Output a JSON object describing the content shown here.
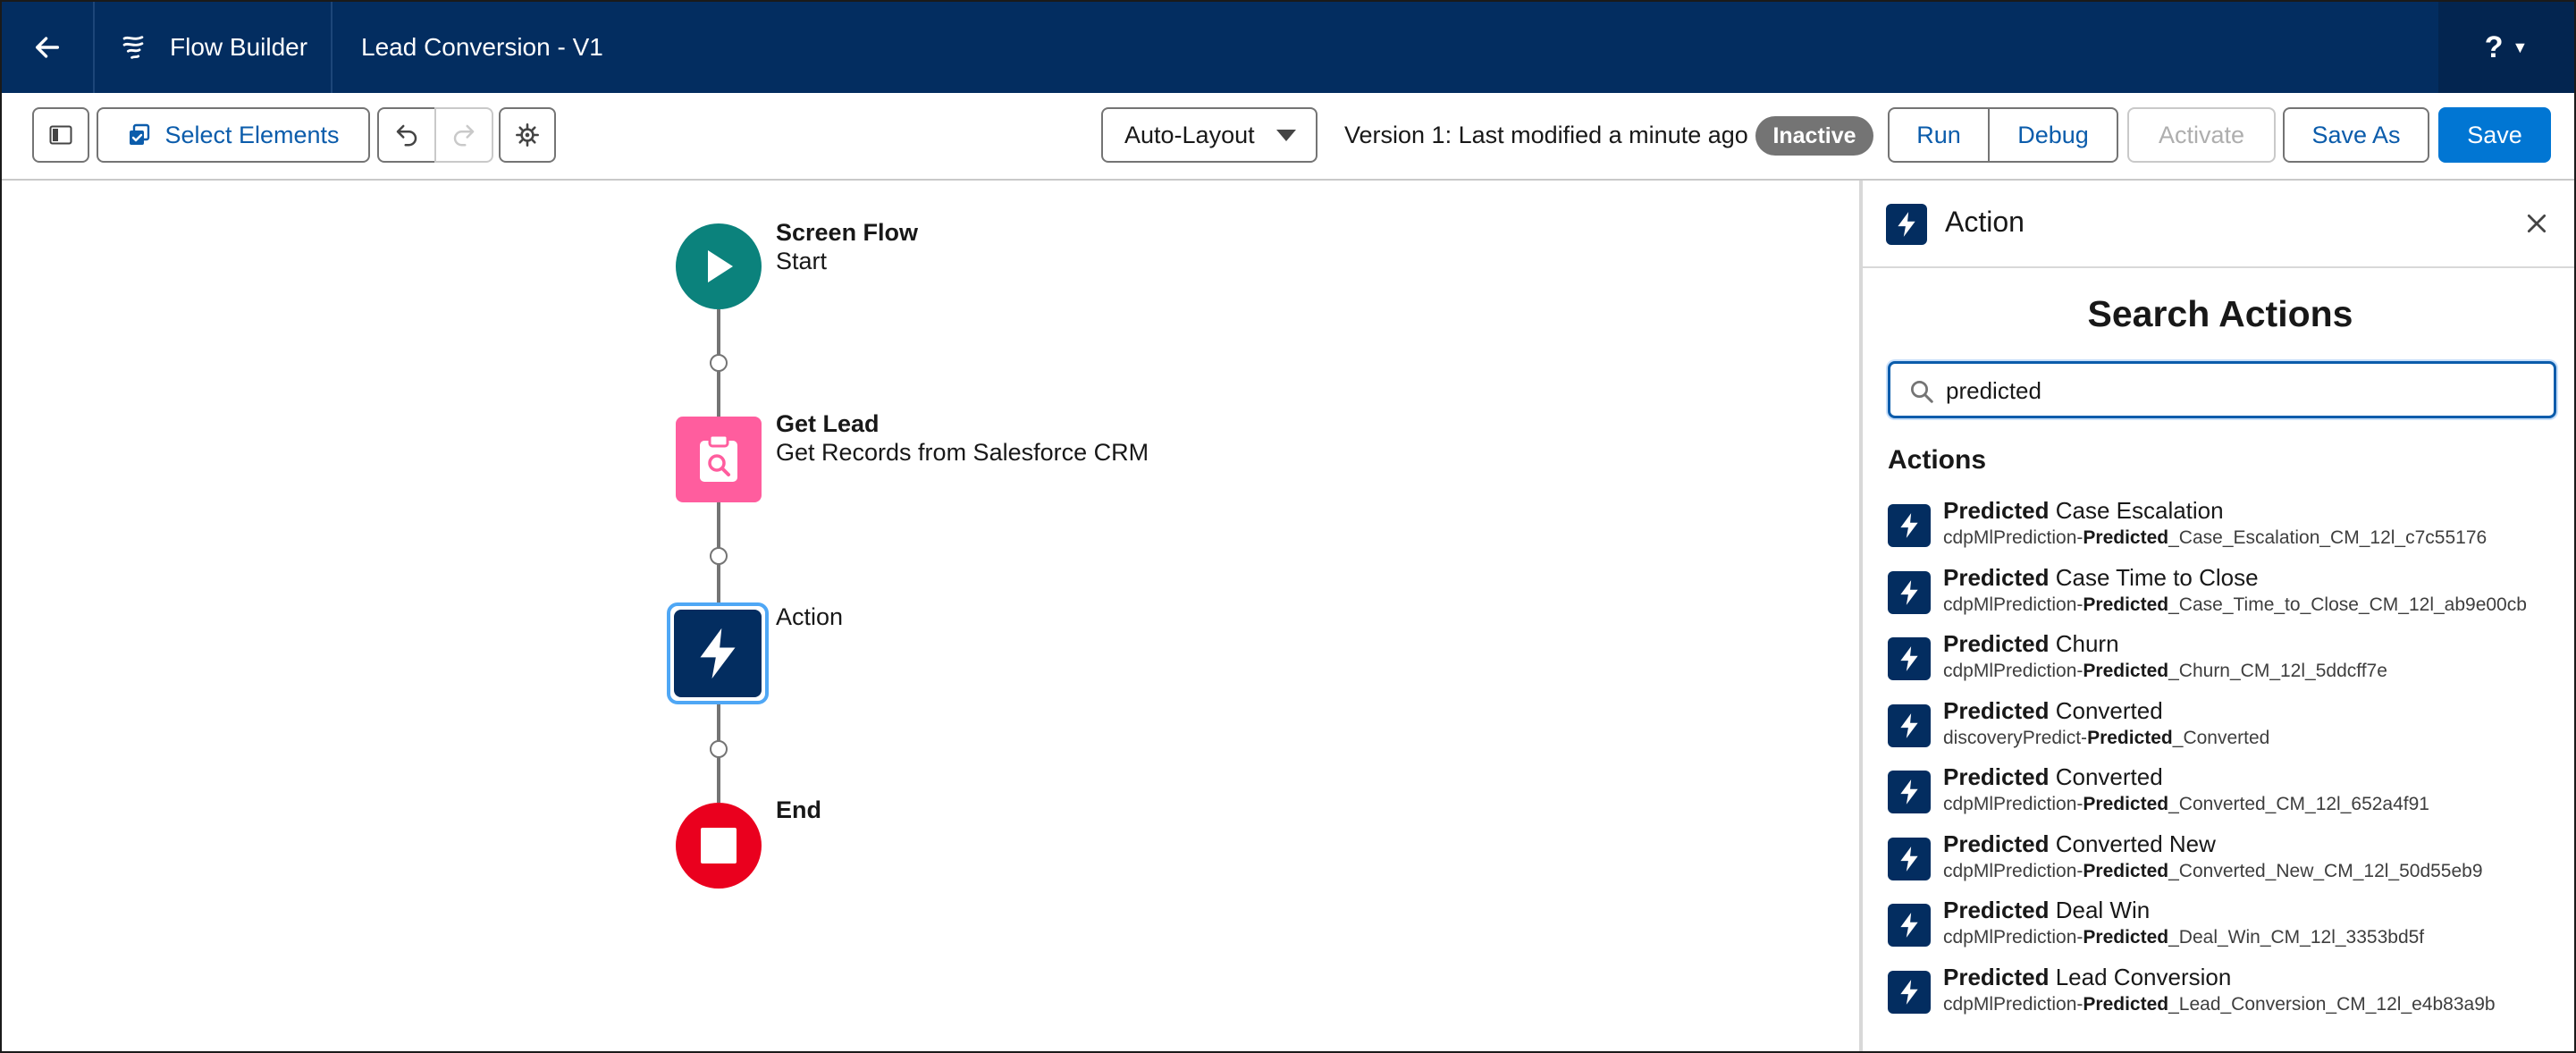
{
  "header": {
    "app_name": "Flow Builder",
    "flow_title": "Lead Conversion - V1",
    "help_label": "?"
  },
  "toolbar": {
    "select_elements_label": "Select Elements",
    "layout_mode": "Auto-Layout",
    "version_text": "Version 1: Last modified a minute ago",
    "status_badge": "Inactive",
    "run_label": "Run",
    "debug_label": "Debug",
    "activate_label": "Activate",
    "save_as_label": "Save As",
    "save_label": "Save"
  },
  "canvas": {
    "nodes": [
      {
        "title": "Screen Flow",
        "subtitle": "Start",
        "type": "start"
      },
      {
        "title": "Get Lead",
        "subtitle": "Get Records from Salesforce CRM",
        "type": "get-records"
      },
      {
        "title": "",
        "subtitle": "Action",
        "type": "action"
      },
      {
        "title": "End",
        "subtitle": "",
        "type": "end"
      }
    ]
  },
  "panel": {
    "title": "Action",
    "search_heading": "Search Actions",
    "search_value": "predicted",
    "section_label": "Actions",
    "results": [
      {
        "bold": "Predicted",
        "rest": " Case Escalation",
        "sub_pre": "cdpMlPrediction-",
        "sub_bold": "Predicted",
        "sub_post": "_Case_Escalation_CM_12l_c7c55176"
      },
      {
        "bold": "Predicted",
        "rest": " Case Time to Close",
        "sub_pre": "cdpMlPrediction-",
        "sub_bold": "Predicted",
        "sub_post": "_Case_Time_to_Close_CM_12l_ab9e00cb"
      },
      {
        "bold": "Predicted",
        "rest": " Churn",
        "sub_pre": "cdpMlPrediction-",
        "sub_bold": "Predicted",
        "sub_post": "_Churn_CM_12l_5ddcff7e"
      },
      {
        "bold": "Predicted",
        "rest": " Converted",
        "sub_pre": "discoveryPredict-",
        "sub_bold": "Predicted",
        "sub_post": "_Converted"
      },
      {
        "bold": "Predicted",
        "rest": " Converted",
        "sub_pre": "cdpMlPrediction-",
        "sub_bold": "Predicted",
        "sub_post": "_Converted_CM_12l_652a4f91"
      },
      {
        "bold": "Predicted",
        "rest": " Converted New",
        "sub_pre": "cdpMlPrediction-",
        "sub_bold": "Predicted",
        "sub_post": "_Converted_New_CM_12l_50d55eb9"
      },
      {
        "bold": "Predicted",
        "rest": " Deal Win",
        "sub_pre": "cdpMlPrediction-",
        "sub_bold": "Predicted",
        "sub_post": "_Deal_Win_CM_12l_3353bd5f"
      },
      {
        "bold": "Predicted",
        "rest": " Lead Conversion",
        "sub_pre": "cdpMlPrediction-",
        "sub_bold": "Predicted",
        "sub_post": "_Lead_Conversion_CM_12l_e4b83a9b"
      }
    ]
  },
  "colors": {
    "header_bg": "#032d60",
    "brand_blue": "#0176d3",
    "start_node": "#0b827c",
    "get_records_node": "#ff5d9e",
    "action_node": "#032d60",
    "end_node": "#ea001e",
    "badge_gray": "#747474"
  },
  "icons": {
    "back": "arrow-left-icon",
    "app_logo": "flow-logo-icon",
    "panel_toggle": "panel-toggle-icon",
    "select_elements": "multi-select-icon",
    "undo": "undo-icon",
    "redo": "redo-icon",
    "settings": "gear-icon",
    "start": "play-icon",
    "get_records": "clipboard-search-icon",
    "action": "lightning-bolt-icon",
    "end": "stop-icon",
    "close": "close-icon",
    "search": "search-icon"
  }
}
